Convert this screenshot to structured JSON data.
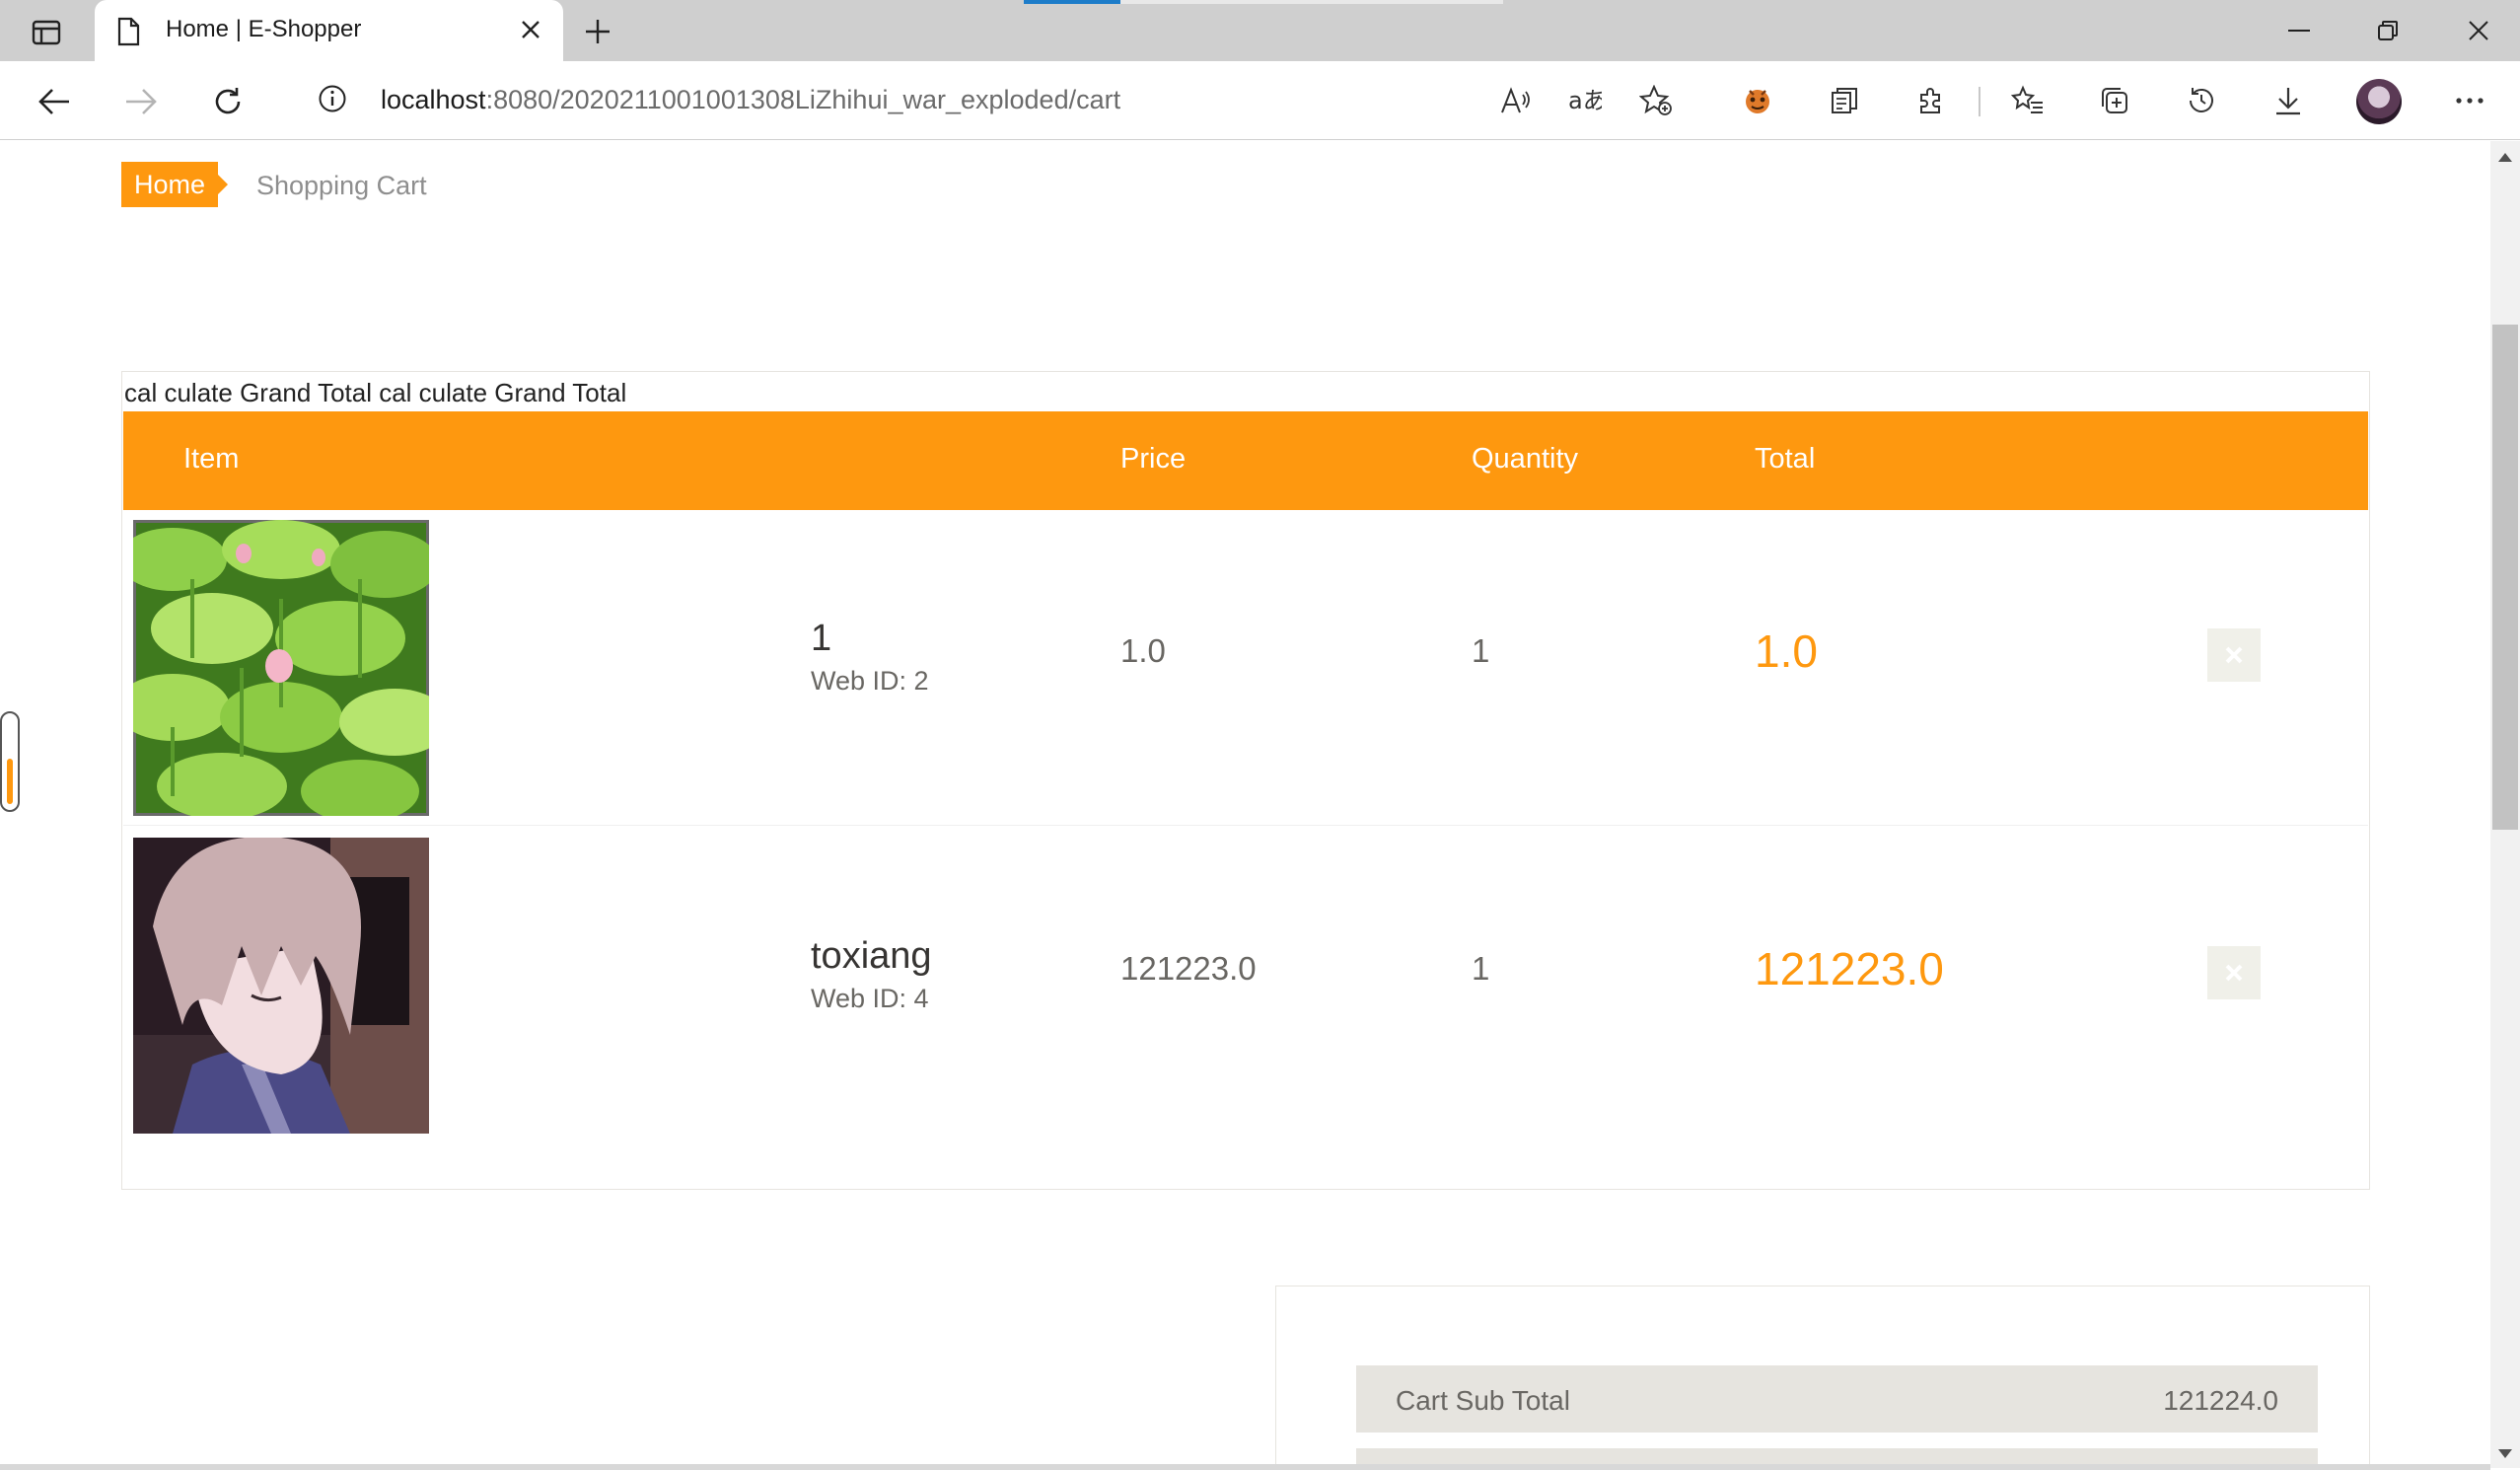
{
  "browser": {
    "tab_title": "Home | E-Shopper",
    "url_host": "localhost",
    "url_rest": ":8080/2020211001001308LiZhihui_war_exploded/cart"
  },
  "breadcrumb": {
    "home": "Home",
    "current": "Shopping Cart"
  },
  "cart": {
    "caption": "cal culate Grand Total cal culate Grand Total",
    "headers": {
      "item": "Item",
      "price": "Price",
      "quantity": "Quantity",
      "total": "Total"
    },
    "rows": [
      {
        "name": "1",
        "web_id": "Web ID: 2",
        "price": "1.0",
        "quantity": "1",
        "total": "1.0",
        "image": "lotus-leaves-photo"
      },
      {
        "name": "toxiang",
        "web_id": "Web ID: 4",
        "price": "121223.0",
        "quantity": "1",
        "total": "121223.0",
        "image": "anime-character-portrait"
      }
    ]
  },
  "totals": {
    "subtotal_label": "Cart Sub Total",
    "subtotal_value": "121224.0"
  },
  "colors": {
    "accent": "#fe980f",
    "muted_text": "#696763",
    "row_bg": "#e6e4df"
  }
}
